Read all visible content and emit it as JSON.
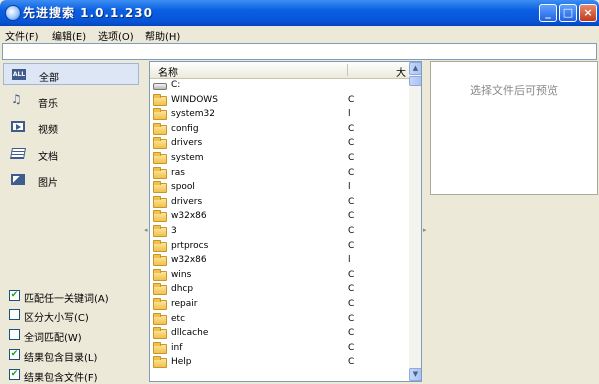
{
  "window": {
    "title": "先进搜索 1.0.1.230",
    "controls": {
      "minimize": "_",
      "maximize": "□",
      "close": "×"
    }
  },
  "menu": [
    {
      "label": "文件(F)"
    },
    {
      "label": "编辑(E)"
    },
    {
      "label": "选项(O)"
    },
    {
      "label": "帮助(H)"
    }
  ],
  "search": {
    "value": "",
    "placeholder": ""
  },
  "categories": [
    {
      "label": "全部",
      "icon": "all-icon",
      "active": true
    },
    {
      "label": "音乐",
      "icon": "music-icon",
      "active": false
    },
    {
      "label": "视频",
      "icon": "video-icon",
      "active": false
    },
    {
      "label": "文档",
      "icon": "document-icon",
      "active": false
    },
    {
      "label": "图片",
      "icon": "image-icon",
      "active": false
    }
  ],
  "options": [
    {
      "label": "匹配任一关键词(A)",
      "checked": true
    },
    {
      "label": "区分大小写(C)",
      "checked": false
    },
    {
      "label": "全词匹配(W)",
      "checked": false
    },
    {
      "label": "结果包含目录(L)",
      "checked": true
    },
    {
      "label": "结果包含文件(F)",
      "checked": true
    }
  ],
  "file_list": {
    "columns": {
      "name": "名称",
      "size": "大"
    },
    "rows": [
      {
        "name": "C:",
        "size": "",
        "type": "drive"
      },
      {
        "name": "WINDOWS",
        "size": "C",
        "type": "folder"
      },
      {
        "name": "system32",
        "size": "l",
        "type": "folder"
      },
      {
        "name": "config",
        "size": "C",
        "type": "folder"
      },
      {
        "name": "drivers",
        "size": "C",
        "type": "folder"
      },
      {
        "name": "system",
        "size": "C",
        "type": "folder"
      },
      {
        "name": "ras",
        "size": "C",
        "type": "folder"
      },
      {
        "name": "spool",
        "size": "l",
        "type": "folder"
      },
      {
        "name": "drivers",
        "size": "C",
        "type": "folder"
      },
      {
        "name": "w32x86",
        "size": "C",
        "type": "folder"
      },
      {
        "name": "3",
        "size": "C",
        "type": "folder"
      },
      {
        "name": "prtprocs",
        "size": "C",
        "type": "folder"
      },
      {
        "name": "w32x86",
        "size": "l",
        "type": "folder"
      },
      {
        "name": "wins",
        "size": "C",
        "type": "folder"
      },
      {
        "name": "dhcp",
        "size": "C",
        "type": "folder"
      },
      {
        "name": "repair",
        "size": "C",
        "type": "folder"
      },
      {
        "name": "etc",
        "size": "C",
        "type": "folder"
      },
      {
        "name": "dllcache",
        "size": "C",
        "type": "folder"
      },
      {
        "name": "inf",
        "size": "C",
        "type": "folder"
      },
      {
        "name": "Help",
        "size": "C",
        "type": "folder"
      }
    ]
  },
  "preview": {
    "placeholder": "选择文件后可预览"
  },
  "colors": {
    "titlebar": "#0a5fe0",
    "window_bg": "#ece9d8",
    "active_category": "#dce6f4"
  }
}
